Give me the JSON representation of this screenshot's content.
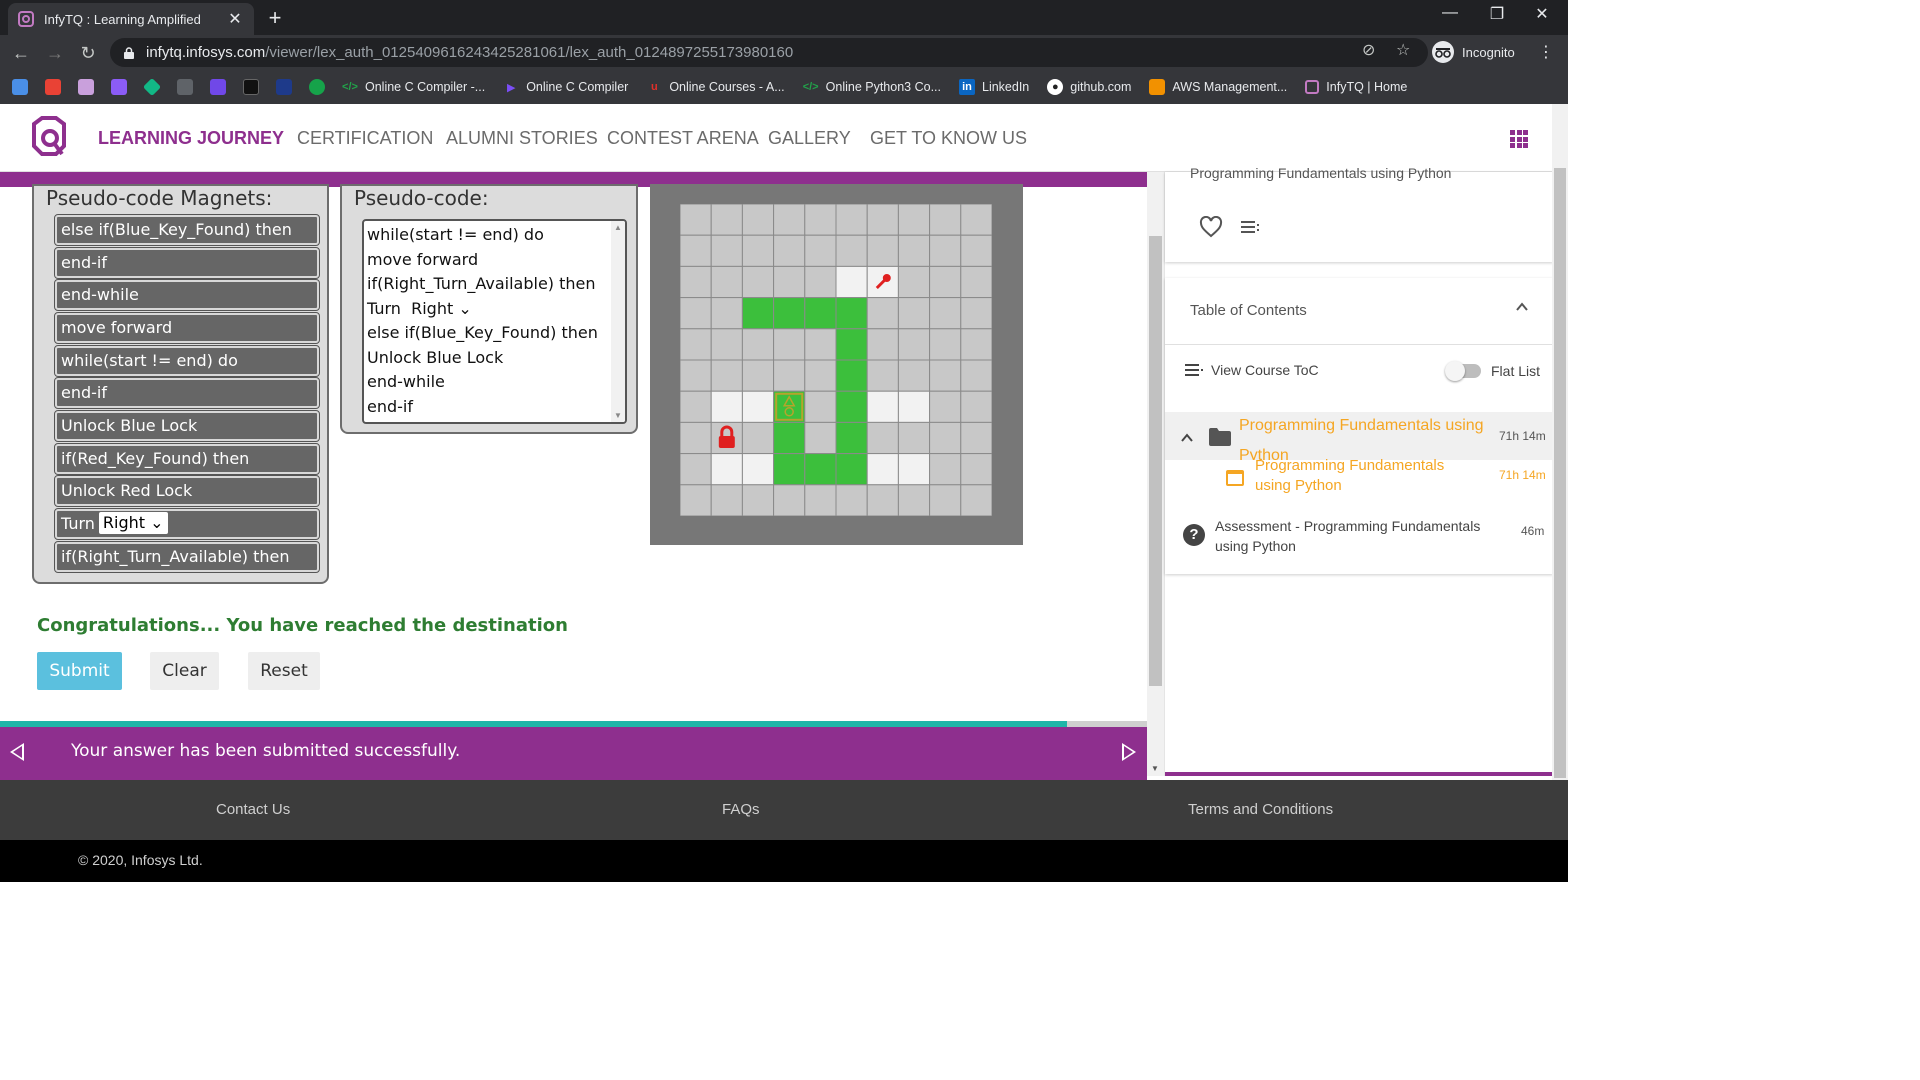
{
  "browser": {
    "tab_title": "InfyTQ : Learning Amplified",
    "url_host": "infytq.infosys.com",
    "url_path": "/viewer/lex_auth_01254096162434252810​61/lex_auth_0124897255173980160",
    "incognito_label": "Incognito",
    "bookmarks": [
      {
        "label": "Online C Compiler -...",
        "icon_color": "#22a34a"
      },
      {
        "label": "Online C Compiler",
        "icon_color": "#7b4ef7"
      },
      {
        "label": "Online Courses - A...",
        "icon_color": "#e0302a"
      },
      {
        "label": "Online Python3 Co...",
        "icon_color": "#22a34a"
      },
      {
        "label": "LinkedIn",
        "icon_color": "#0a66c2"
      },
      {
        "label": "github.com",
        "icon_color": "#ffffff"
      },
      {
        "label": "AWS Management...",
        "icon_color": "#f29100"
      },
      {
        "label": "InfyTQ | Home",
        "icon_color": "#8e2f8e"
      }
    ]
  },
  "header": {
    "nav": [
      "LEARNING JOURNEY",
      "CERTIFICATION",
      "ALUMNI STORIES",
      "CONTEST ARENA",
      "GALLERY",
      "GET TO KNOW US"
    ],
    "brand_color": "#8e2f8e"
  },
  "magnets": {
    "title": "Pseudo-code Magnets:",
    "items": [
      "else if(Blue_Key_Found) then",
      "end-if",
      "end-while",
      "move forward",
      "while(start != end) do",
      "end-if",
      "Unlock Blue Lock",
      "if(Red_Key_Found) then",
      "Unlock Red Lock",
      "Turn",
      "if(Right_Turn_Available) then"
    ],
    "turn_option": "Right"
  },
  "pseudocode": {
    "title": "Pseudo-code:",
    "lines": [
      "while(start != end) do",
      "move forward",
      "if(Right_Turn_Available) then",
      "Turn",
      "else if(Blue_Key_Found) then",
      "Unlock Blue Lock",
      "end-while",
      "end-if"
    ],
    "turn_option": "Right"
  },
  "game": {
    "rows": 10,
    "cols": 10,
    "cells": [
      "gggggggggg",
      "gggggggggg",
      "gggggwkggg",
      "ggGGGGgggg",
      "gggggGgggg",
      "gggggGgggg",
      "gwwrgGwwgg",
      "glgGgGgggg",
      "gwwGGGwwgg",
      "gggggggggg"
    ],
    "colors": {
      "gray": "#c8c8c8",
      "white": "#f2f2f2",
      "green": "#3cbf3c",
      "border": "#8a8a8a"
    }
  },
  "status": {
    "congrats": "Congratulations... You have reached the destination",
    "submit": "Submit",
    "clear": "Clear",
    "reset": "Reset",
    "submitted_msg": "Your answer has been submitted successfully.",
    "progress": 0.93
  },
  "sidebar": {
    "course_title": "Programming Fundamentals using Python",
    "toc_title": "Table of Contents",
    "view_toc": "View Course ToC",
    "flat_list": "Flat List",
    "items": [
      {
        "title": "Programming Fundamentals using Python",
        "duration": "71h 14m"
      },
      {
        "title": "Programming Fundamentals using Python",
        "duration": "71h 14m"
      },
      {
        "title": "Assessment - Programming Fundamentals using Python",
        "duration": "46m"
      }
    ]
  },
  "footer": {
    "links": [
      "Contact Us",
      "FAQs",
      "Terms and Conditions"
    ],
    "copyright": "© 2020, Infosys Ltd."
  }
}
